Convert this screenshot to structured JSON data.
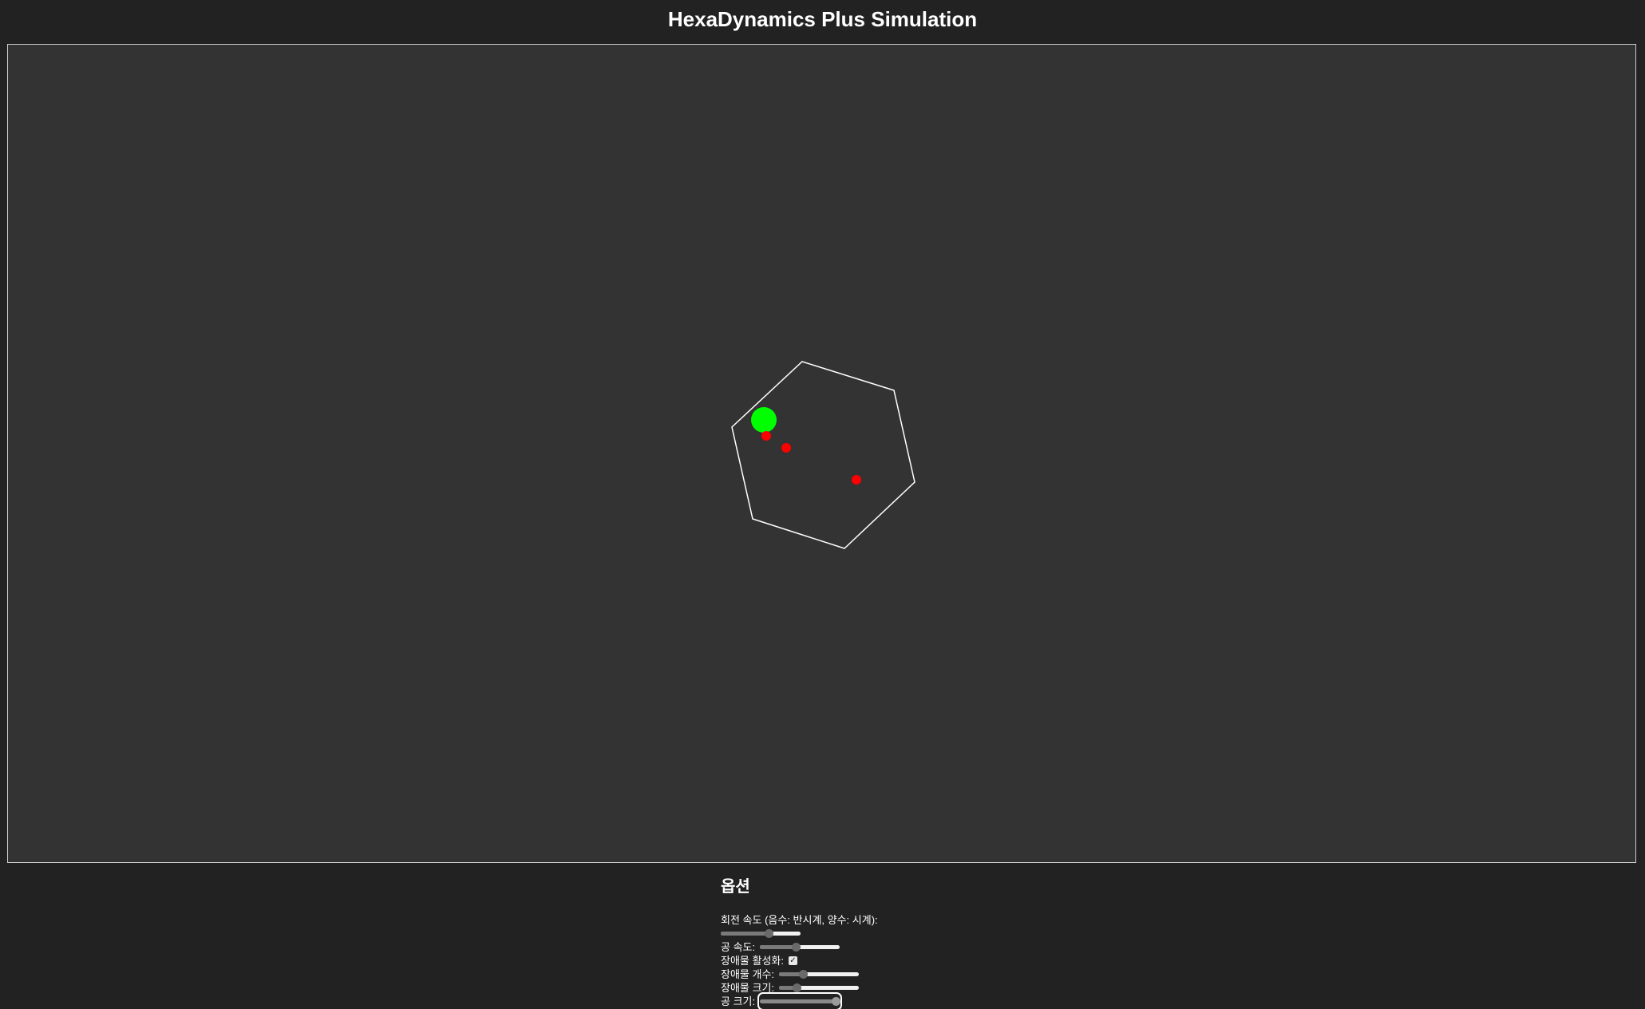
{
  "page": {
    "title": "HexaDynamics Plus Simulation"
  },
  "simulation": {
    "hexagon": {
      "stroke_color": "#ffffff"
    },
    "ball": {
      "color": "#00ff00"
    },
    "obstacles": {
      "color": "#ff0000",
      "count_visible": 3
    },
    "background_color": "#333333"
  },
  "options": {
    "heading": "옵션",
    "rotation_speed": {
      "label": "회전 속도 (음수: 반시계, 양수: 시계):",
      "level": 0.6
    },
    "ball_speed": {
      "label": "공 속도:",
      "level": 0.45
    },
    "obstacles_enabled": {
      "label": "장애물 활성화:",
      "checked": true,
      "check_glyph": "✓"
    },
    "obstacle_count": {
      "label": "장애물 개수:",
      "level": 0.3
    },
    "obstacle_size": {
      "label": "장애물 크기:",
      "level": 0.22
    },
    "ball_size": {
      "label": "공 크기:",
      "level": 0.95
    }
  }
}
